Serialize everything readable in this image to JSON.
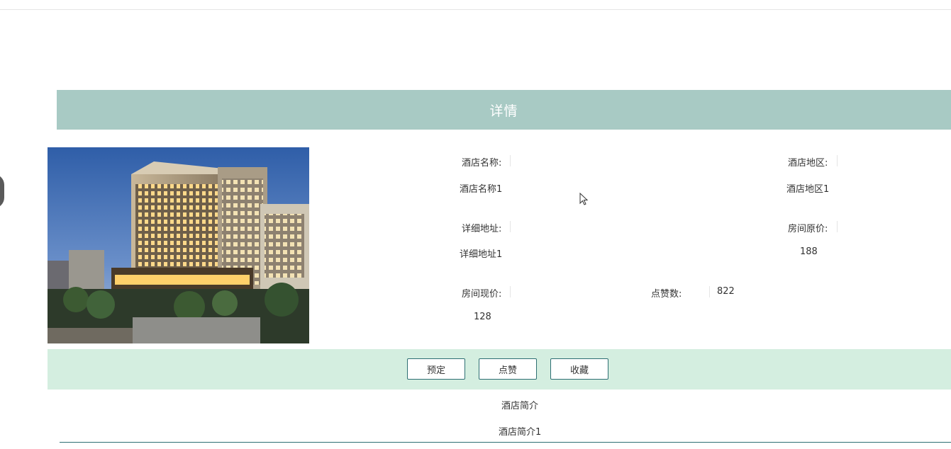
{
  "page": {
    "title": "详情"
  },
  "hotel": {
    "image_alt": "酒店图片",
    "fields": {
      "name_label": "酒店名称:",
      "name_value": "酒店名称1",
      "region_label": "酒店地区:",
      "region_value": "酒店地区1",
      "address_label": "详细地址:",
      "address_value": "详细地址1",
      "original_price_label": "房间原价:",
      "original_price_value": "188",
      "current_price_label": "房间现价:",
      "current_price_value": "128",
      "likes_label": "点赞数:",
      "likes_value": "822"
    }
  },
  "actions": {
    "book_label": "预定",
    "like_label": "点赞",
    "favorite_label": "收藏"
  },
  "intro": {
    "title": "酒店简介",
    "text": "酒店简介1"
  },
  "colors": {
    "header_bg": "#a8cac4",
    "button_bar_bg": "#d4eee0",
    "button_border": "#2e6f73"
  }
}
